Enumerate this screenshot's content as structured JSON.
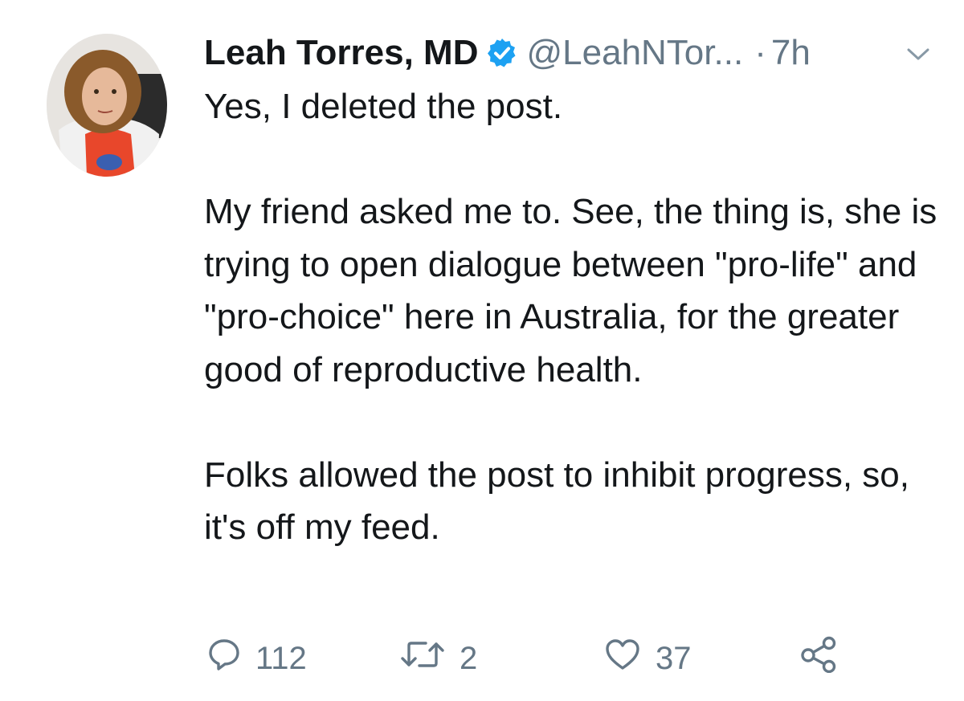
{
  "tweet": {
    "display_name": "Leah Torres, MD",
    "handle": "@LeahNTor...",
    "separator": "·",
    "time": "7h",
    "text": "Yes, I deleted the post.\n\nMy friend asked me to. See, the thing is, she is trying to open dialogue between \"pro-life\" and \"pro-choice\" here in Australia, for the greater good of reproductive health.\n\nFolks allowed the post to inhibit progress, so, it's off my feed.",
    "replies": "112",
    "retweets": "2",
    "likes": "37"
  },
  "icons": {
    "verified": "verified-badge-icon",
    "caret": "chevron-down-icon",
    "reply": "reply-icon",
    "retweet": "retweet-icon",
    "like": "heart-icon",
    "share": "share-icon"
  },
  "colors": {
    "verified": "#1da1f2",
    "secondary_text": "#657786",
    "primary_text": "#14171a"
  }
}
